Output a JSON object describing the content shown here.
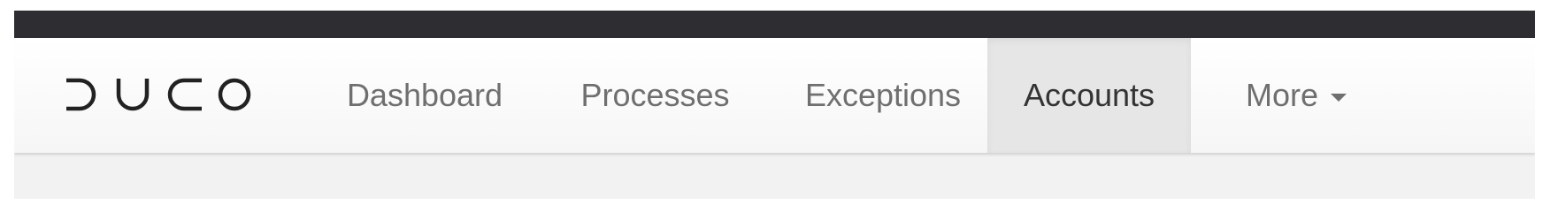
{
  "brand": {
    "logo_text": "DUCO"
  },
  "nav": {
    "items": [
      {
        "label": "Dashboard",
        "active": false
      },
      {
        "label": "Processes",
        "active": false
      },
      {
        "label": "Exceptions",
        "active": false
      },
      {
        "label": "Accounts",
        "active": true
      },
      {
        "label": "More",
        "active": false,
        "icon": "caret-down-icon"
      }
    ]
  },
  "colors": {
    "topbar": "#2e2d31",
    "nav_text": "#6f6f6f",
    "nav_active_text": "#333333",
    "nav_active_bg": "#e6e6e6",
    "page_bg": "#f2f2f2"
  }
}
